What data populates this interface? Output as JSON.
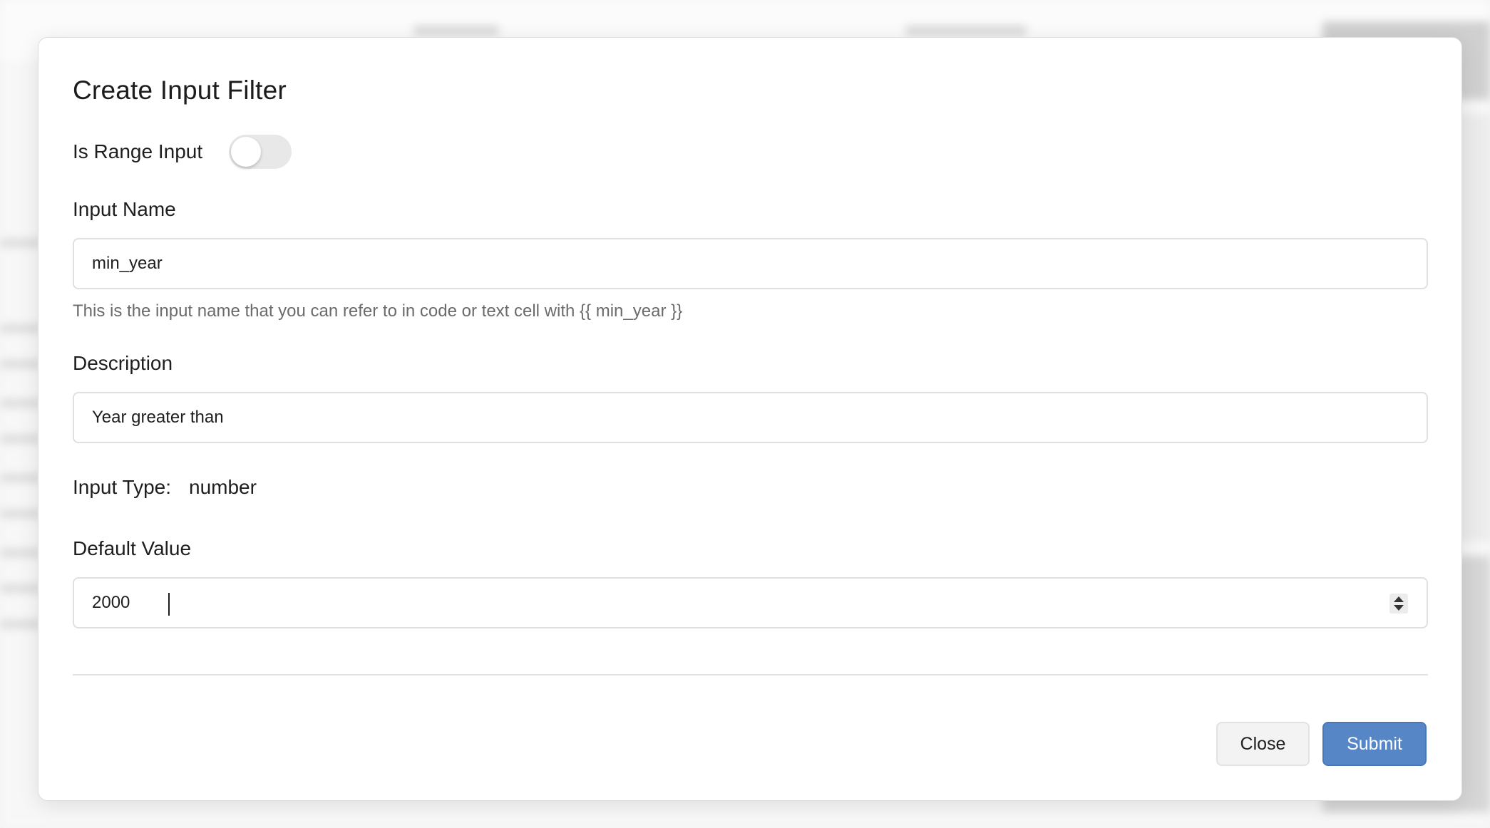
{
  "modal": {
    "title": "Create Input Filter",
    "range_toggle": {
      "label": "Is Range Input",
      "checked": false
    },
    "input_name": {
      "label": "Input Name",
      "value": "min_year",
      "help_text": "This is the input name that you can refer to in code or text cell with {{ min_year }}"
    },
    "description": {
      "label": "Description",
      "value": "Year greater than"
    },
    "input_type": {
      "label": "Input Type:",
      "value": "number"
    },
    "default_value": {
      "label": "Default Value",
      "value": "2000"
    },
    "buttons": {
      "close": "Close",
      "submit": "Submit"
    }
  },
  "colors": {
    "submit_bg": "#5686c6",
    "toggle_off": "#e8e8e8",
    "help_text": "#6b6b6b"
  }
}
